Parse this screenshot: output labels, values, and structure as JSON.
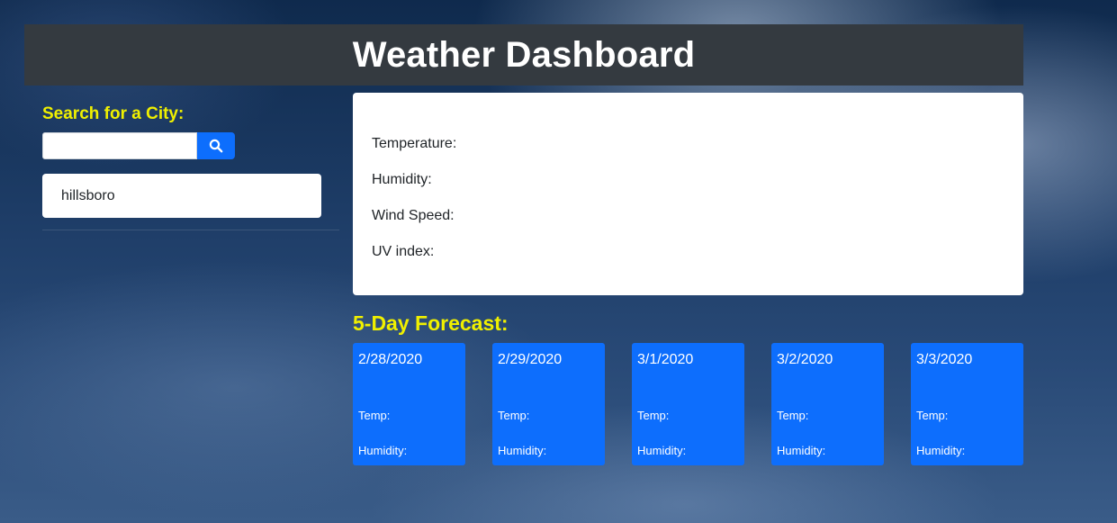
{
  "header": {
    "title": "Weather Dashboard"
  },
  "search": {
    "label": "Search for a City:",
    "value": "",
    "placeholder": "",
    "button_icon": "search-icon"
  },
  "history": {
    "items": [
      {
        "label": "hillsboro"
      }
    ]
  },
  "current": {
    "temperature_label": "Temperature:",
    "humidity_label": "Humidity:",
    "wind_label": "Wind Speed:",
    "uv_label": "UV index:"
  },
  "forecast": {
    "title": "5-Day Forecast:",
    "days": [
      {
        "date": "2/28/2020",
        "temp_label": "Temp:",
        "humidity_label": "Humidity:"
      },
      {
        "date": "2/29/2020",
        "temp_label": "Temp:",
        "humidity_label": "Humidity:"
      },
      {
        "date": "3/1/2020",
        "temp_label": "Temp:",
        "humidity_label": "Humidity:"
      },
      {
        "date": "3/2/2020",
        "temp_label": "Temp:",
        "humidity_label": "Humidity:"
      },
      {
        "date": "3/3/2020",
        "temp_label": "Temp:",
        "humidity_label": "Humidity:"
      }
    ]
  },
  "colors": {
    "header_bg": "#343a40",
    "accent_yellow": "#f0f000",
    "primary_blue": "#0d6efd"
  }
}
